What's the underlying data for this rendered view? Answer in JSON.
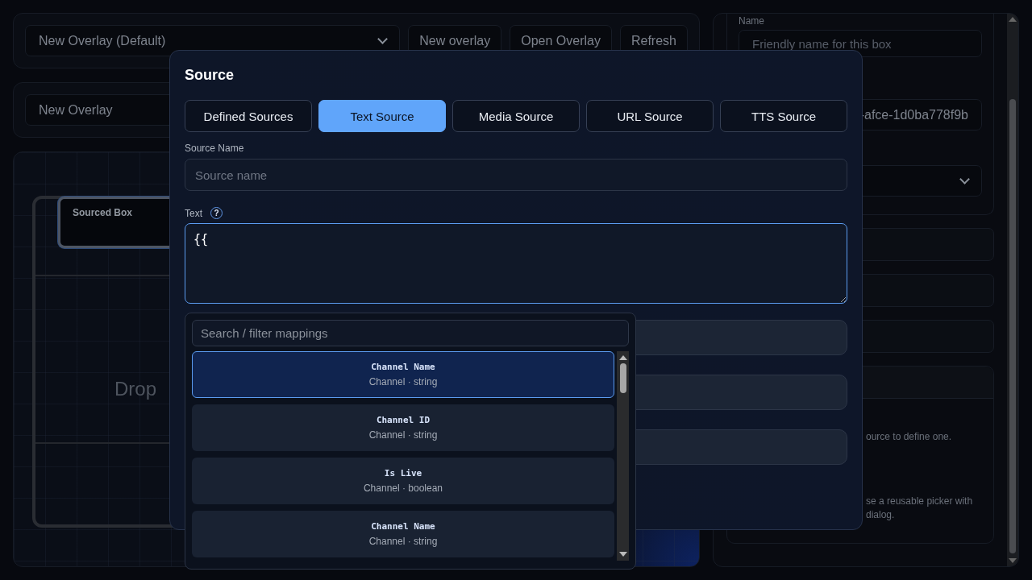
{
  "toolbar": {
    "overlay_select": "New Overlay (Default)",
    "buttons": [
      "New overlay",
      "Open Overlay",
      "Refresh"
    ]
  },
  "overlay_name": "New Overlay",
  "canvas": {
    "box_label": "Sourced Box",
    "drop_text": "Drop"
  },
  "inspector": {
    "name_label": "Name",
    "name_placeholder": "Friendly name for this box",
    "id_value": "-afce-1d0ba778f9b",
    "hints": [
      "ource to define one.",
      "se a reusable picker with",
      "dialog."
    ]
  },
  "dialog": {
    "title": "Source",
    "tabs": [
      {
        "label": "Defined Sources",
        "selected": false
      },
      {
        "label": "Text Source",
        "selected": true
      },
      {
        "label": "Media Source",
        "selected": false
      },
      {
        "label": "URL Source",
        "selected": false
      },
      {
        "label": "TTS Source",
        "selected": false
      }
    ],
    "source_name_label": "Source Name",
    "source_name_placeholder": "Source name",
    "text_label": "Text",
    "help": "?",
    "text_value": "{{"
  },
  "mapping_picker": {
    "placeholder": "Search / filter mappings",
    "items": [
      {
        "name": "Channel Name",
        "meta": "Channel · string",
        "selected": true
      },
      {
        "name": "Channel ID",
        "meta": "Channel · string",
        "selected": false
      },
      {
        "name": "Is Live",
        "meta": "Channel · boolean",
        "selected": false
      },
      {
        "name": "Channel Name",
        "meta": "Channel · string",
        "selected": false
      }
    ]
  }
}
